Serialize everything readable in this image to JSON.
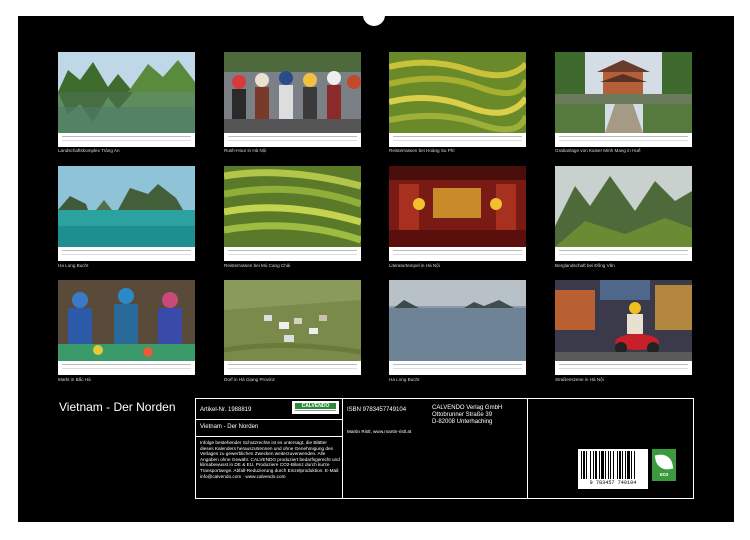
{
  "thumbnails": [
    {
      "caption": "Landschaftskomplex Tràng An"
    },
    {
      "caption": "Rush-Hour in Hà Nội"
    },
    {
      "caption": "Reisterrassen bei Hoàng Su Phì"
    },
    {
      "caption": "Grabanlage von Kaiser Minh Mang in Huế"
    },
    {
      "caption": "Ha Long Bucht"
    },
    {
      "caption": "Reisterrassen bei Mù Cang Chải"
    },
    {
      "caption": "Literaturtempel in Hà Nội"
    },
    {
      "caption": "Berglandschaft bei Đồng Văn"
    },
    {
      "caption": "Markt in Bắc Hà"
    },
    {
      "caption": "Dorf in Hà Giang Provinz"
    },
    {
      "caption": "Ha Long Bucht"
    },
    {
      "caption": "Straßenszene in Hà Nội"
    }
  ],
  "title": "Vietnam - Der Norden",
  "panel": {
    "article": "Artikel-Nr. 1988819",
    "logo_text": "CALVENDO",
    "subtitle": "Vietnam - Der Norden",
    "body": "Infolge bestehender Schutzrechte ist es untersagt, die Blätter dieses Kalenders herauszutrennen und ohne Genehmigung des Verlages zu gewerblichen Zwecken weiterzuverwenden. Alle Angaben ohne Gewähr. CALVENDO produziert bedarfsgerecht und klimabewusst in DE & EU. Produziere CO2-Bilanz durch kurze Transportwege. Abfall-Reduzierung durch Einzelproduktion. E-Mail: info@calvendo.com · www.calvendo.com",
    "isbn": "ISBN 9783457749104",
    "author": "Martin Ristl, www.martin-ristl.at",
    "publisher_lines": [
      "CALVENDO Verlag GmbH",
      "Ottobrunner Straße 39",
      "D-82008 Unterhaching"
    ],
    "barcode_number": "9 783457 749104",
    "eco_label": "eco"
  }
}
